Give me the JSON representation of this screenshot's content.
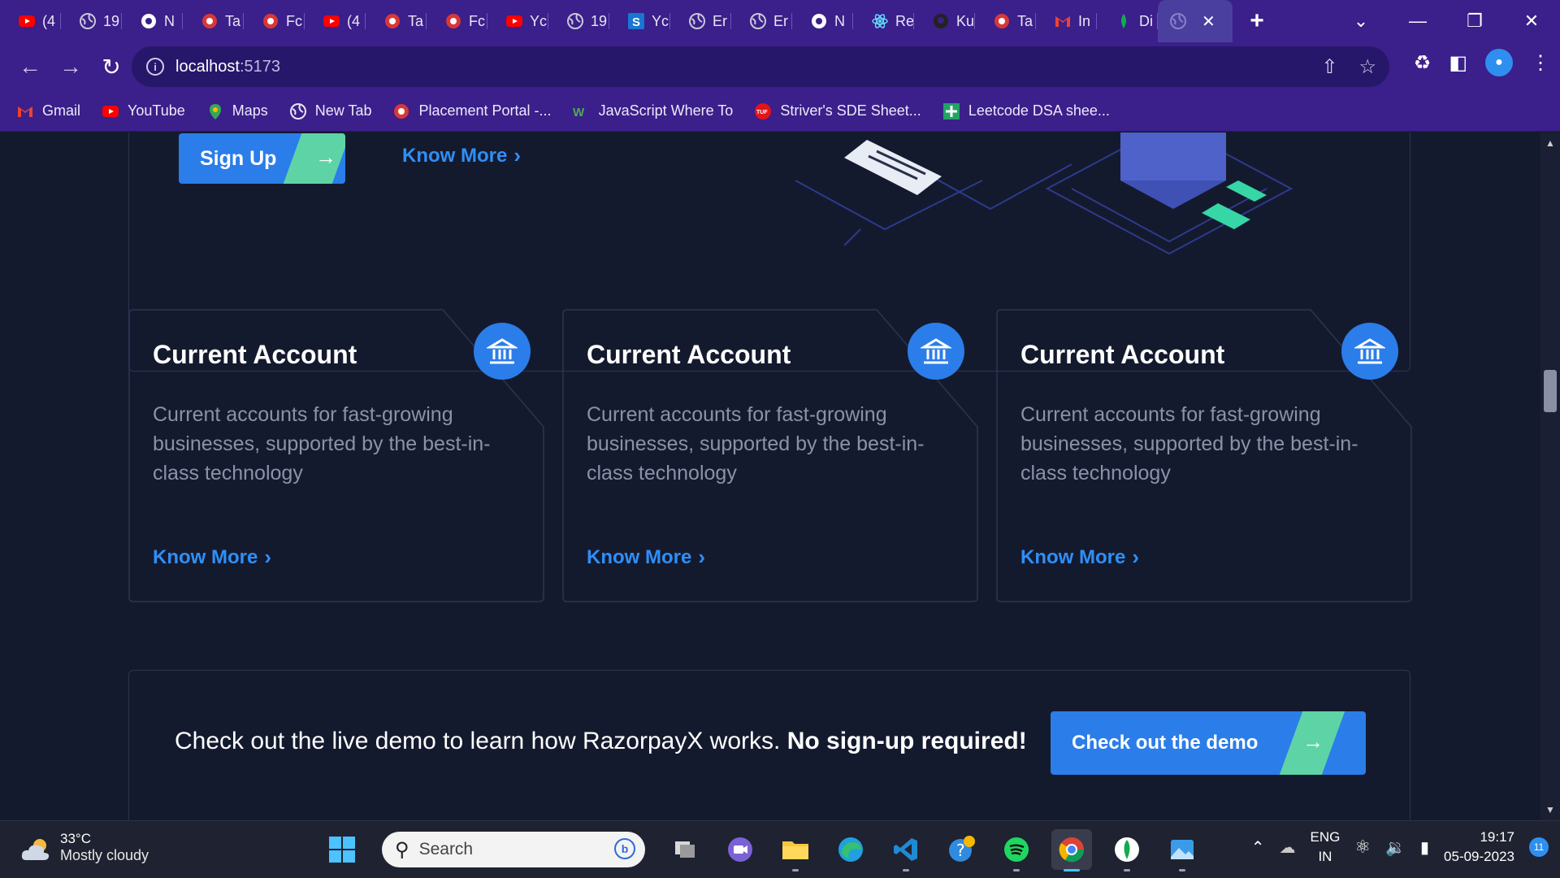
{
  "browser": {
    "tabs": [
      {
        "label": "(4",
        "icon": "youtube-icon",
        "color": "#ff0000"
      },
      {
        "label": "19",
        "icon": "globe-icon",
        "color": "#c8c8d8"
      },
      {
        "label": "N",
        "icon": "chrome-icon",
        "color": "#ffffff"
      },
      {
        "label": "Ta",
        "icon": "red-circle-icon",
        "color": "#d93737"
      },
      {
        "label": "Fc",
        "icon": "red-circle-icon",
        "color": "#d93737"
      },
      {
        "label": "(4",
        "icon": "youtube-icon",
        "color": "#ff0000"
      },
      {
        "label": "Ta",
        "icon": "red-circle-icon",
        "color": "#d93737"
      },
      {
        "label": "Fc",
        "icon": "red-circle-icon",
        "color": "#d93737"
      },
      {
        "label": "Yc",
        "icon": "youtube-icon",
        "color": "#ff0000"
      },
      {
        "label": "19",
        "icon": "globe-icon",
        "color": "#c8c8d8"
      },
      {
        "label": "Yc",
        "icon": "s-square-icon",
        "color": "#1976d2"
      },
      {
        "label": "Er",
        "icon": "globe-icon",
        "color": "#c8c8d8"
      },
      {
        "label": "Er",
        "icon": "globe-icon",
        "color": "#c8c8d8"
      },
      {
        "label": "N",
        "icon": "chrome-icon",
        "color": "#ffffff"
      },
      {
        "label": "Re",
        "icon": "react-icon",
        "color": "#61dafb"
      },
      {
        "label": "Ku",
        "icon": "github-icon",
        "color": "#222222"
      },
      {
        "label": "Ta",
        "icon": "red-circle-icon",
        "color": "#d93737"
      },
      {
        "label": "In",
        "icon": "gmail-icon",
        "color": "#ea4335"
      },
      {
        "label": "Di",
        "icon": "leaf-icon",
        "color": "#13aa52"
      }
    ],
    "active_tab": {
      "icon": "globe-icon",
      "close": "✕"
    },
    "new_tab": "+",
    "address": {
      "host": "localhost",
      "port": ":5173"
    },
    "bookmarks": [
      {
        "label": "Gmail",
        "icon": "gmail-icon"
      },
      {
        "label": "YouTube",
        "icon": "youtube-icon"
      },
      {
        "label": "Maps",
        "icon": "maps-icon"
      },
      {
        "label": "New Tab",
        "icon": "globe-icon"
      },
      {
        "label": "Placement Portal -...",
        "icon": "red-circle-icon"
      },
      {
        "label": "JavaScript Where To",
        "icon": "w3-icon"
      },
      {
        "label": "Striver's SDE Sheet...",
        "icon": "tuf-icon"
      },
      {
        "label": "Leetcode DSA shee...",
        "icon": "plus-square-icon"
      }
    ]
  },
  "hero": {
    "signup_label": "Sign Up",
    "know_more_label": "Know More"
  },
  "cards": [
    {
      "title": "Current Account",
      "desc": "Current accounts for fast-growing businesses, supported by the best-in-class technology",
      "link": "Know More"
    },
    {
      "title": "Current Account",
      "desc": "Current accounts for fast-growing businesses, supported by the best-in-class technology",
      "link": "Know More"
    },
    {
      "title": "Current Account",
      "desc": "Current accounts for fast-growing businesses, supported by the best-in-class technology",
      "link": "Know More"
    }
  ],
  "demo": {
    "text": "Check out the live demo to learn how RazorpayX works.",
    "bold": "No sign-up required!",
    "button": "Check out the demo"
  },
  "taskbar": {
    "weather_temp": "33°C",
    "weather_desc": "Mostly cloudy",
    "search_placeholder": "Search",
    "lang_top": "ENG",
    "lang_bottom": "IN",
    "time": "19:17",
    "date": "05-09-2023",
    "notification_count": "11"
  },
  "colors": {
    "accent_blue": "#2b7de9",
    "accent_green": "#5ed3a6",
    "page_bg": "#141a2e",
    "browser_purple": "#3b1f8a"
  }
}
